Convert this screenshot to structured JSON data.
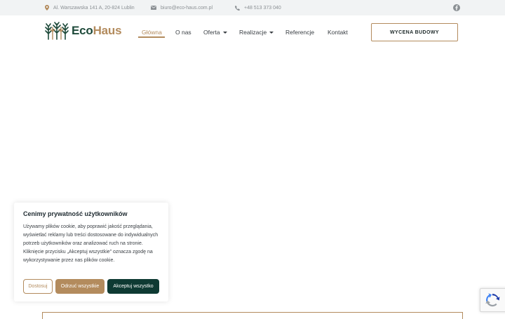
{
  "topbar": {
    "address": "Al. Warszawska 141 A, 20-824 Lublin",
    "email": "biuro@eco-haus.com.pl",
    "phone": "+48 513 373 040",
    "icons": {
      "address": "map-pin-icon",
      "email": "envelope-icon",
      "phone": "phone-icon",
      "social": "facebook-icon"
    }
  },
  "logo": {
    "part1": "Eco",
    "part2": "Haus"
  },
  "nav": {
    "items": [
      {
        "label": "Główna",
        "active": true
      },
      {
        "label": "O nas"
      },
      {
        "label": "Oferta",
        "dropdown": true
      },
      {
        "label": "Realizacje",
        "dropdown": true
      },
      {
        "label": "Referencje"
      },
      {
        "label": "Kontakt"
      }
    ]
  },
  "cta": {
    "label": "WYCENA BUDOWY"
  },
  "cookie": {
    "title": "Cenimy prywatność użytkowników",
    "text": "Używamy plików cookie, aby poprawić jakość przeglądania, wyświetlać reklamy lub treści dostosowane do indywidualnych potrzeb użytkowników oraz analizować ruch na stronie. Kliknięcie przycisku „Akceptuj wszystkie” oznacza zgodę na wykorzystywanie przez nas plików cookie.",
    "customize": "Dostosuj",
    "reject": "Odrzuć wszystkie",
    "accept": "Akceptuj wszystko"
  },
  "colors": {
    "accent": "#b38b5d",
    "brand_dark": "#1e4a3a",
    "accept_bg": "#0e3a33",
    "topbar_bg": "#f1f3f4"
  }
}
